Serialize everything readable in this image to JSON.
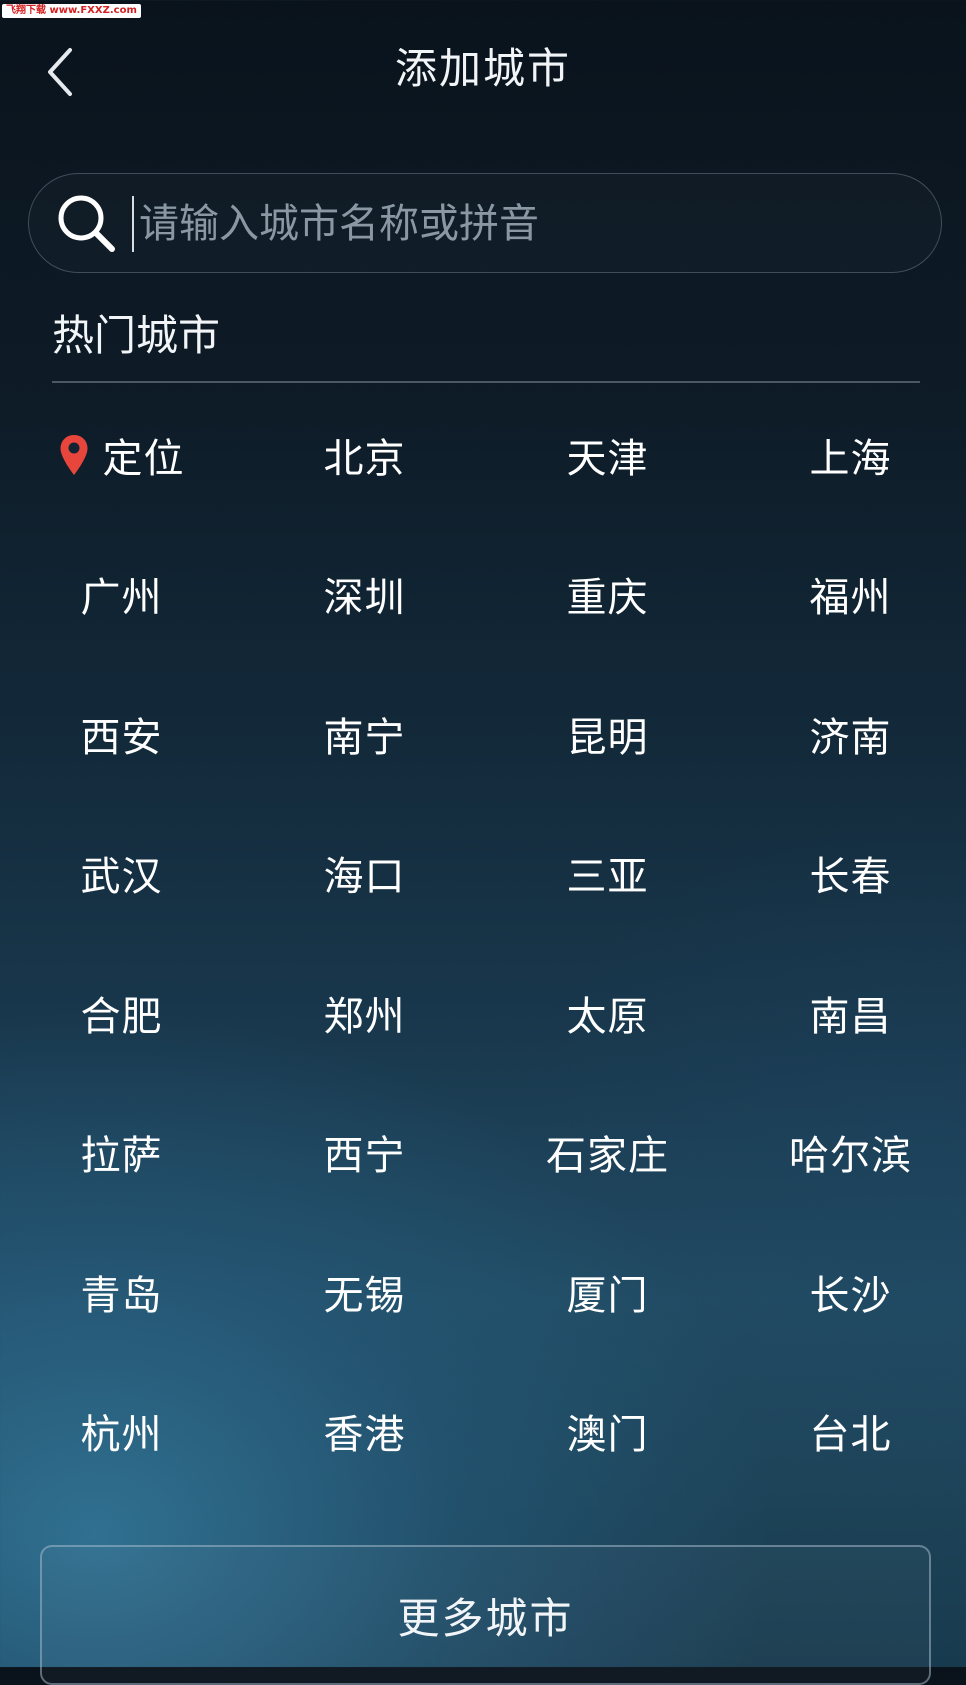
{
  "watermark": "飞翔下载 www.FXXZ.com",
  "header": {
    "title": "添加城市"
  },
  "search": {
    "placeholder": "请输入城市名称或拼音",
    "value": ""
  },
  "hot_section": {
    "title": "热门城市",
    "locate_label": "定位",
    "cities": [
      "北京",
      "天津",
      "上海",
      "广州",
      "深圳",
      "重庆",
      "福州",
      "西安",
      "南宁",
      "昆明",
      "济南",
      "武汉",
      "海口",
      "三亚",
      "长春",
      "合肥",
      "郑州",
      "太原",
      "南昌",
      "拉萨",
      "西宁",
      "石家庄",
      "哈尔滨",
      "青岛",
      "无锡",
      "厦门",
      "长沙",
      "杭州",
      "香港",
      "澳门",
      "台北"
    ]
  },
  "more_button": {
    "label": "更多城市"
  },
  "icons": {
    "back": "chevron-left-icon",
    "search": "search-icon",
    "locate": "location-pin-icon"
  },
  "colors": {
    "pin": "#e8463c",
    "text": "#ffffff",
    "placeholder": "#8a98a4"
  }
}
